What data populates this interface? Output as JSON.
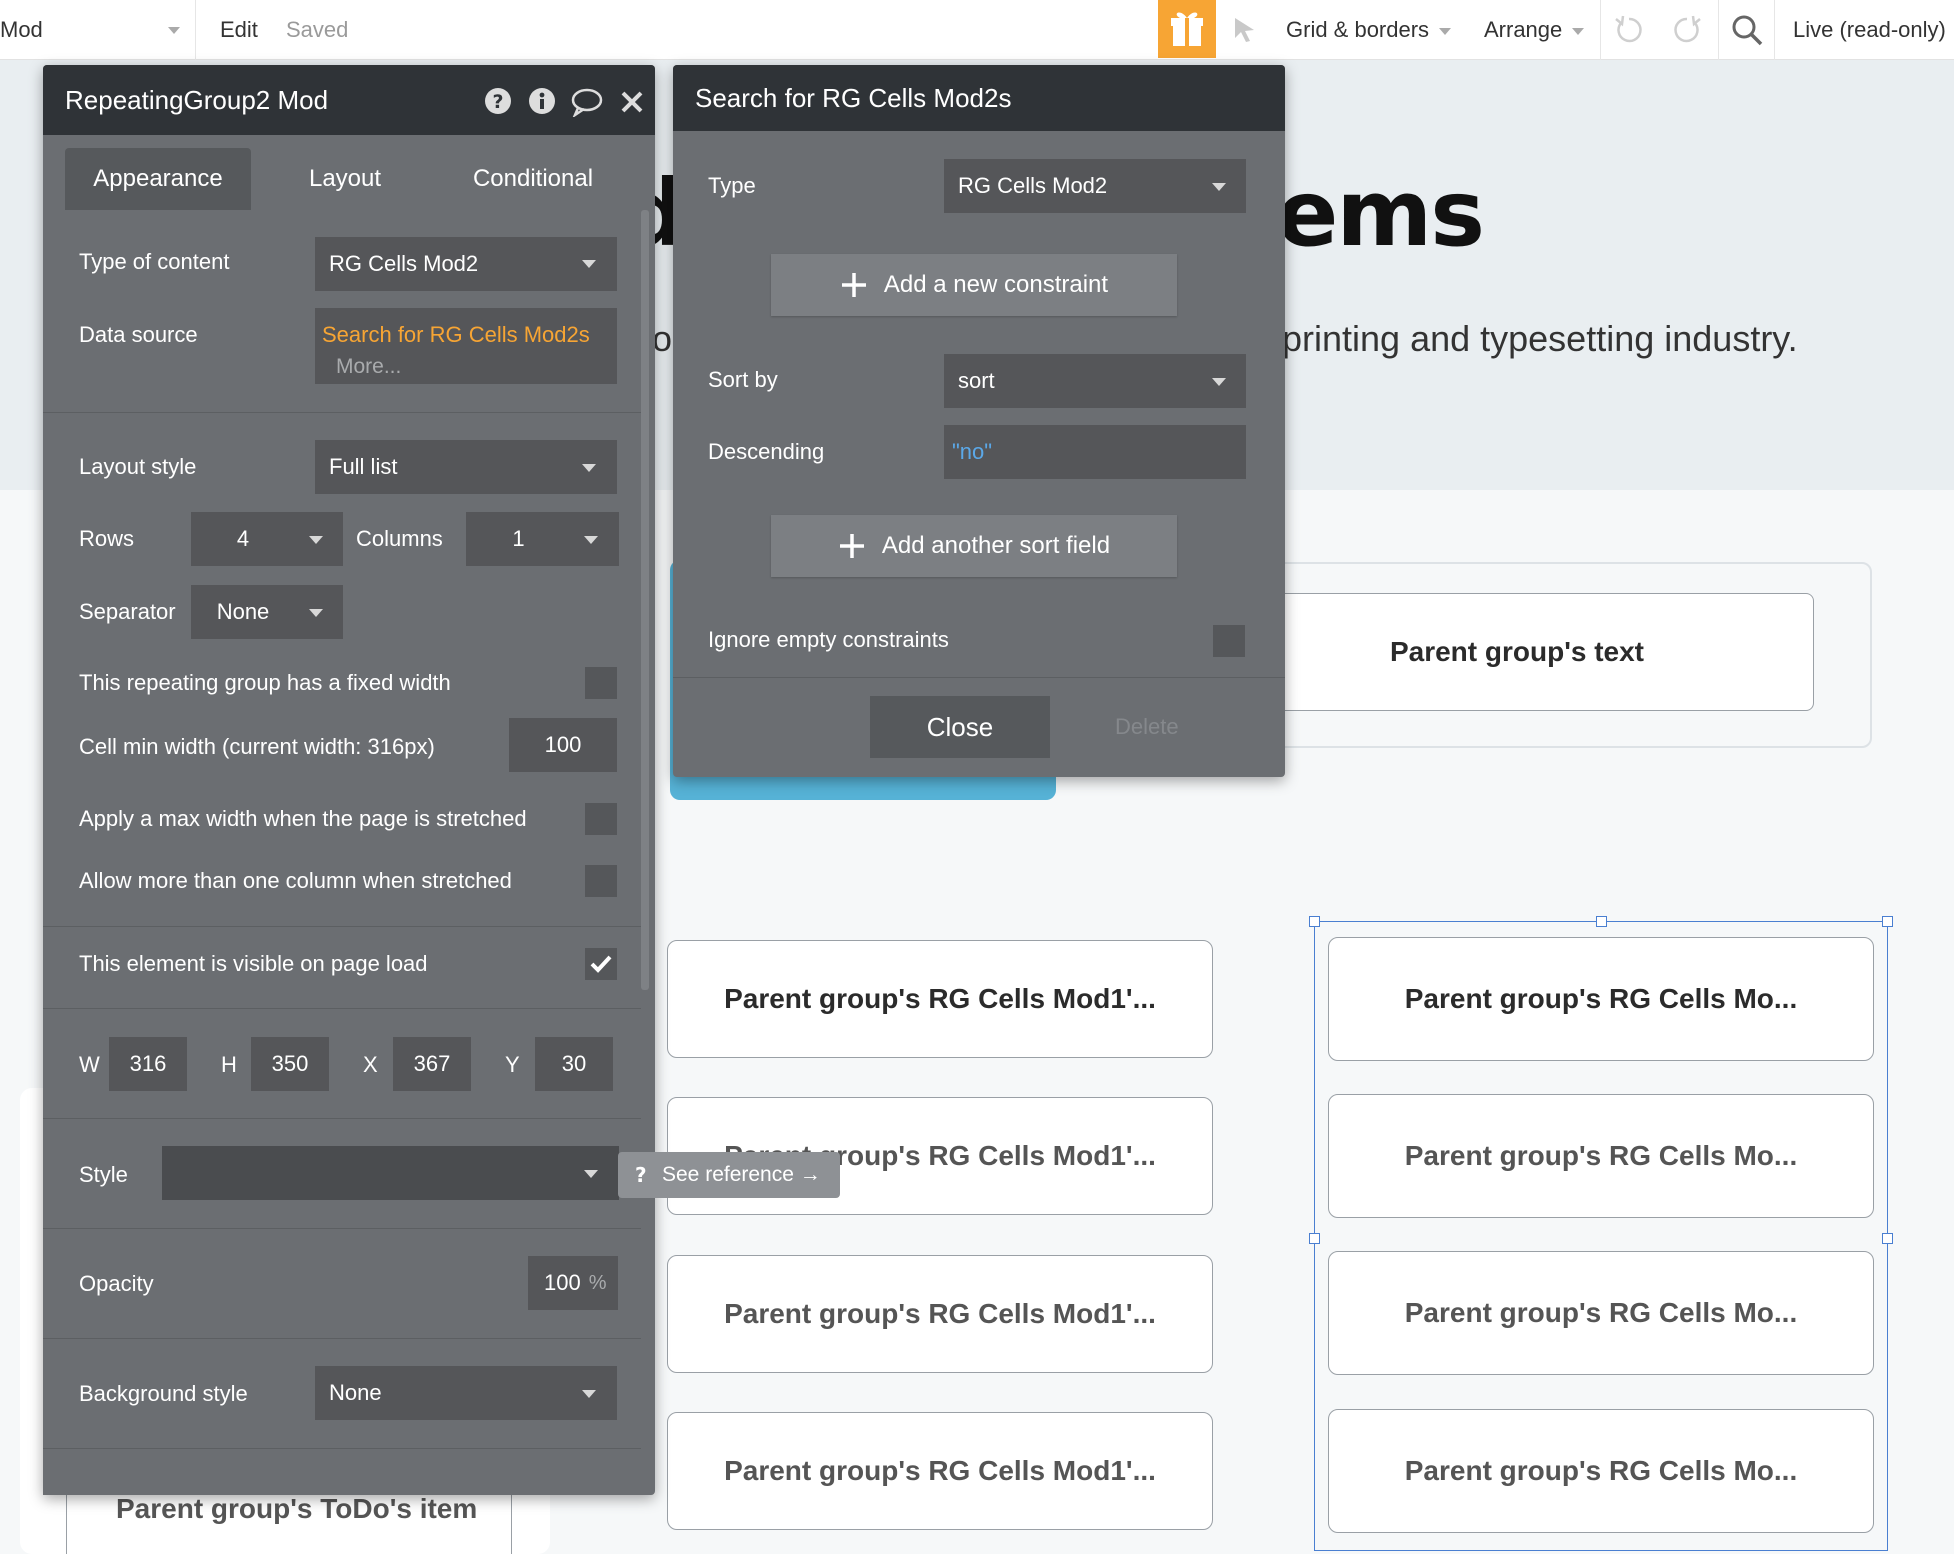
{
  "toolbar": {
    "page_name": "Mod",
    "edit": "Edit",
    "saved": "Saved",
    "grid_borders": "Grid & borders",
    "arrange": "Arrange",
    "live": "Live (read-only)",
    "accent_color": "#f7a534"
  },
  "canvas": {
    "hero_title_left": "d",
    "hero_title_right": "ems",
    "hero_sub_left": "o",
    "hero_sub_right": "printing and typesetting industry.",
    "parent_text": "Parent group's text",
    "left_cells": [
      "Parent group's RG Cells Mod1'...",
      "Parent group's RG Cells Mod1'...",
      "Parent group's RG Cells Mod1'...",
      "Parent group's RG Cells Mod1'..."
    ],
    "right_cells": [
      "Parent group's RG Cells Mo...",
      "Parent group's RG Cells Mo...",
      "Parent group's RG Cells Mo...",
      "Parent group's RG Cells Mo..."
    ],
    "todo_item": "Parent group's ToDo's item"
  },
  "props_panel": {
    "title": "RepeatingGroup2 Mod",
    "tabs": [
      "Appearance",
      "Layout",
      "Conditional"
    ],
    "type_of_content_label": "Type of content",
    "type_of_content_value": "RG Cells Mod2",
    "data_source_label": "Data source",
    "data_source_value": "Search for RG Cells Mod2s",
    "data_source_more": "More...",
    "layout_style_label": "Layout style",
    "layout_style_value": "Full list",
    "rows_label": "Rows",
    "rows_value": "4",
    "columns_label": "Columns",
    "columns_value": "1",
    "separator_label": "Separator",
    "separator_value": "None",
    "fixed_width_label": "This repeating group has a fixed width",
    "cell_min_width_label": "Cell min width (current width: 316px)",
    "cell_min_width_value": "100",
    "max_width_label": "Apply a max width when the page is stretched",
    "more_columns_label": "Allow more than one column when stretched",
    "visible_label": "This element is visible on page load",
    "w_label": "W",
    "w_value": "316",
    "h_label": "H",
    "h_value": "350",
    "x_label": "X",
    "x_value": "367",
    "y_label": "Y",
    "y_value": "30",
    "style_label": "Style",
    "see_reference": "See reference →",
    "opacity_label": "Opacity",
    "opacity_value": "100",
    "opacity_unit": "%",
    "background_style_label": "Background style",
    "background_style_value": "None",
    "data_source_color": "#f7a534"
  },
  "search_panel": {
    "title": "Search for RG Cells Mod2s",
    "type_label": "Type",
    "type_value": "RG Cells Mod2",
    "add_constraint": "Add a new constraint",
    "sort_by_label": "Sort by",
    "sort_by_value": "sort",
    "descending_label": "Descending",
    "descending_value": "\"no\"",
    "add_sort_field": "Add another sort field",
    "ignore_empty_label": "Ignore empty constraints",
    "close": "Close",
    "delete": "Delete"
  }
}
